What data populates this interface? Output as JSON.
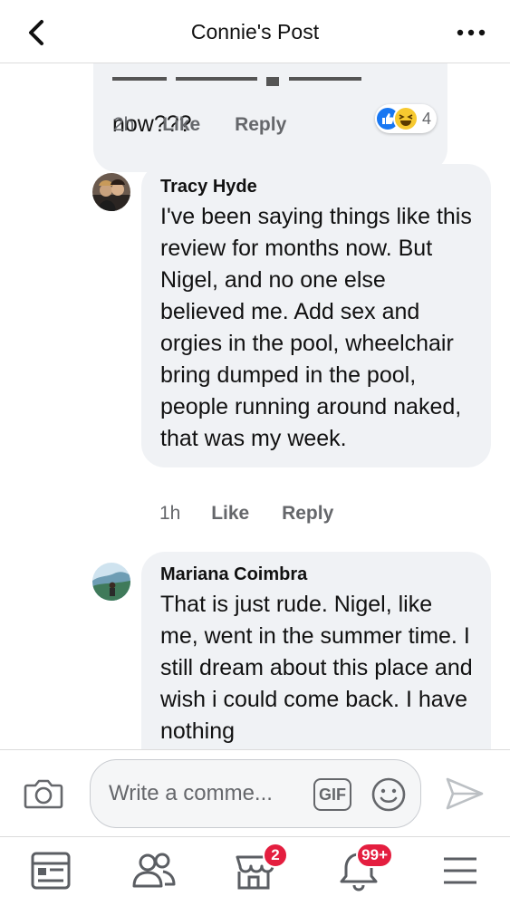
{
  "header": {
    "title": "Connie's Post"
  },
  "previous_comment": {
    "text_tail": "now???",
    "time": "2h",
    "like_label": "Like",
    "reply_label": "Reply",
    "reaction_count": "4"
  },
  "comments": [
    {
      "author": "Tracy Hyde",
      "text": "I've been saying things like this review for months now. But Nigel, and no one else believed me. Add sex and orgies in the pool, wheelchair bring dumped in the pool, people running around naked, that was my week.",
      "time": "1h",
      "like_label": "Like",
      "reply_label": "Reply"
    },
    {
      "author": "Mariana Coimbra",
      "text": "That is just rude. Nigel, like me, went in the summer time. I still dream about this place and wish i could come back. I have nothing"
    }
  ],
  "composer": {
    "placeholder": "Write a comme...",
    "gif_label": "GIF"
  },
  "bottom_nav": {
    "marketplace_badge": "2",
    "notifications_badge": "99+"
  },
  "colors": {
    "accent": "#1877f2",
    "badge": "#e41e3f",
    "bubble": "#f0f2f5",
    "meta_text": "#65676b"
  }
}
